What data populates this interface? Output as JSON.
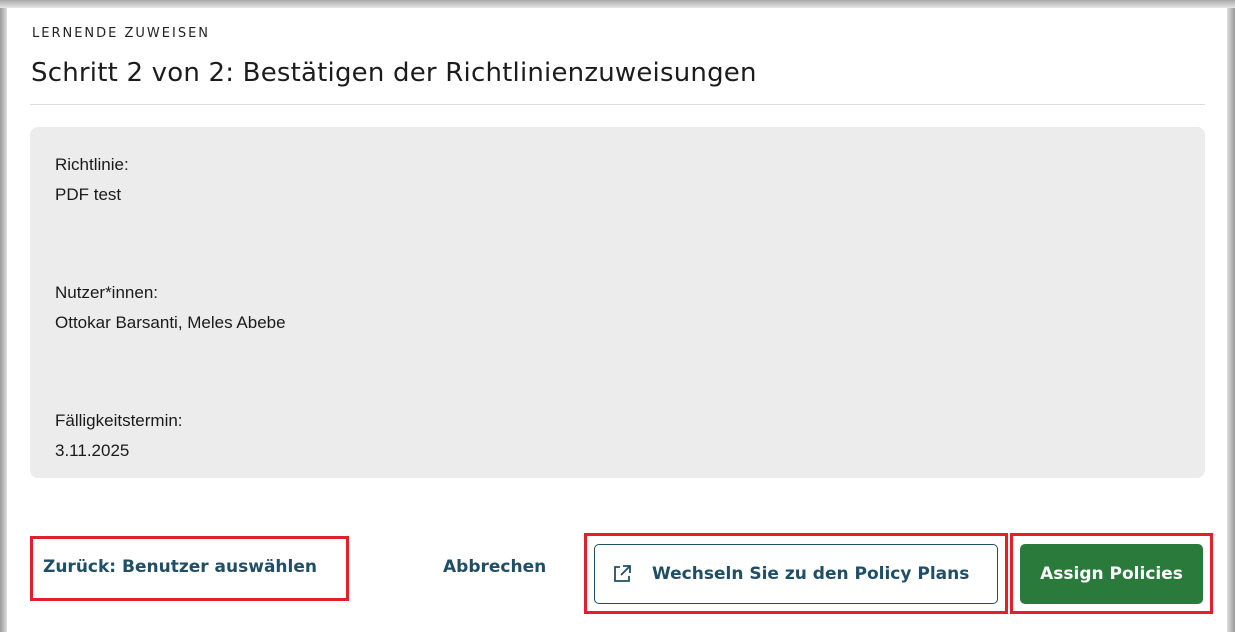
{
  "dialog": {
    "eyebrow": "LERNENDE ZUWEISEN",
    "title": "Schritt 2 von 2: Bestätigen der Richtlinienzuweisungen"
  },
  "summary": {
    "policy_label": "Richtlinie:",
    "policy_value": "PDF test",
    "users_label": "Nutzer*innen:",
    "users_value": "Ottokar Barsanti, Meles Abebe",
    "due_label": "Fälligkeitstermin:",
    "due_value": "3.11.2025"
  },
  "footer": {
    "back_label": "Zurück: Benutzer auswählen",
    "cancel_label": "Abbrechen",
    "switch_label": "Wechseln Sie zu den Policy Plans",
    "switch_icon": "external-link-icon",
    "assign_label": "Assign Policies"
  },
  "colors": {
    "primary_text": "#1f4e66",
    "assign_bg": "#2a7a3b",
    "highlight": "#e0202a",
    "summary_bg": "#ececec"
  }
}
